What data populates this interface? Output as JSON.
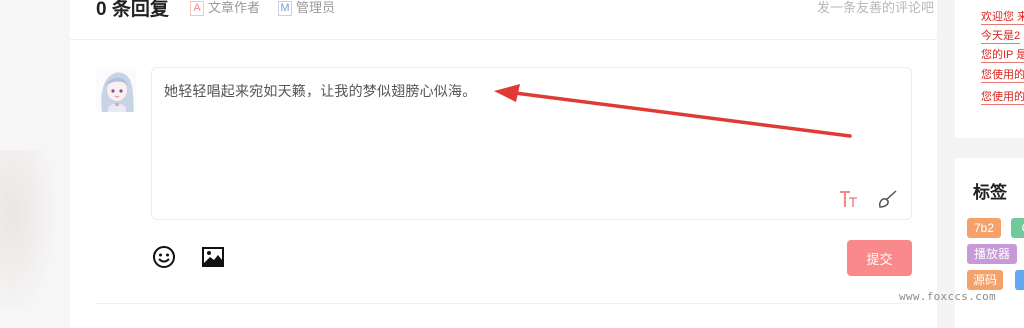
{
  "comments": {
    "reply_count": "0 条回复",
    "author_badge_letter": "A",
    "author_label": "文章作者",
    "admin_badge_letter": "M",
    "admin_label": "管理员",
    "hint": "发一条友善的评论吧",
    "editor_text": "她轻轻唱起来宛如天籁，让我的梦似翅膀心似海。",
    "submit_label": "提交"
  },
  "sidebar": {
    "notices": [
      "欢迎您 来",
      "今天是2",
      "您的IP 是",
      "您使用的",
      "您使用的"
    ],
    "tags_title": "标签",
    "tags": [
      {
        "label": "7b2",
        "color": "#f5a169"
      },
      {
        "label": "C",
        "color": "#72c99a"
      },
      {
        "label": "播放器",
        "color": "#c79ad7"
      },
      {
        "label": "",
        "color": "#5ea9f0"
      },
      {
        "label": "源码",
        "color": "#f5a169"
      },
      {
        "label": "",
        "color": "#5ea9f0"
      }
    ]
  },
  "watermark": "www.foxccs.com",
  "colors": {
    "accent": "#f9898a",
    "arrow": "#e03a35",
    "notice": "#d7261f"
  }
}
